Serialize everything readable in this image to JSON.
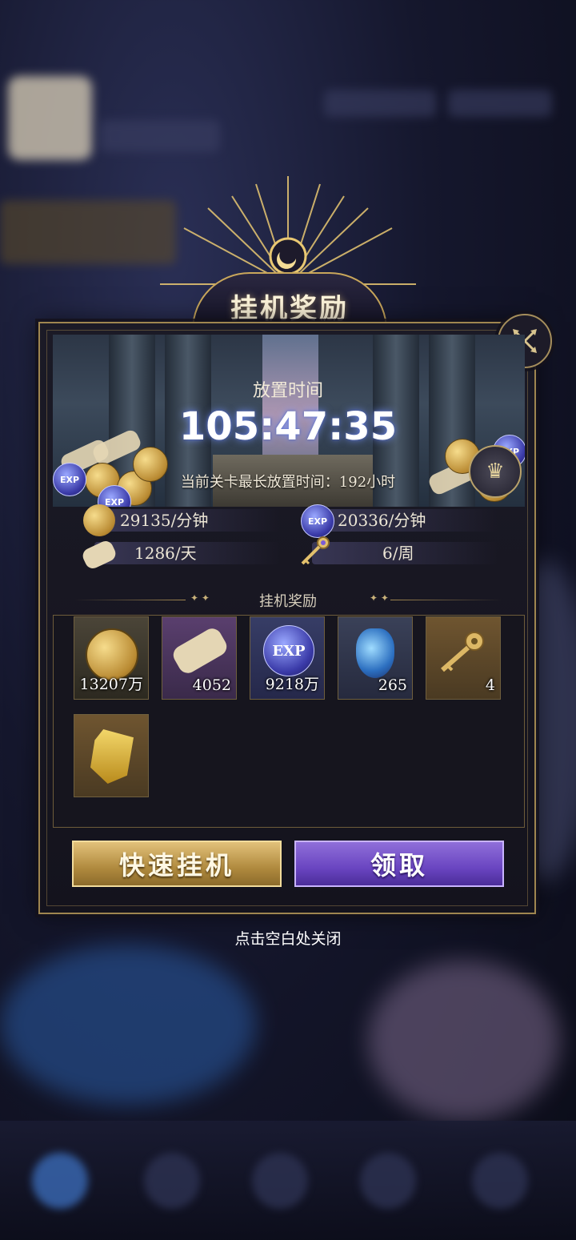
{
  "title": "挂机奖励",
  "idle": {
    "label": "放置时间",
    "time": "105:47:35",
    "max_note": "当前关卡最长放置时间：192小时"
  },
  "rates": [
    {
      "icon": "gold-coin-icon",
      "text": "29135/分钟"
    },
    {
      "icon": "exp-orb-icon",
      "text": "20336/分钟"
    },
    {
      "icon": "scroll-icon",
      "text": "1286/天"
    },
    {
      "icon": "key-icon",
      "text": "6/周"
    }
  ],
  "rewards_section_title": "挂机奖励",
  "rewards": [
    {
      "icon": "gold-coin-icon",
      "count": "13207万"
    },
    {
      "icon": "scroll-icon",
      "count": "4052"
    },
    {
      "icon": "exp-orb-icon",
      "count": "9218万",
      "label": "EXP"
    },
    {
      "icon": "crystal-icon",
      "count": "265"
    },
    {
      "icon": "key-icon",
      "count": "4"
    },
    {
      "icon": "exchange-crystal-icon",
      "count": ""
    }
  ],
  "buttons": {
    "quick_idle": "快速挂机",
    "claim": "领取"
  },
  "close_hint": "点击空白处关闭",
  "exp_badge": "EXP",
  "colors": {
    "gold_border": "#a08650",
    "claim_button": "#6a45c1",
    "quick_button": "#b08a3e"
  }
}
